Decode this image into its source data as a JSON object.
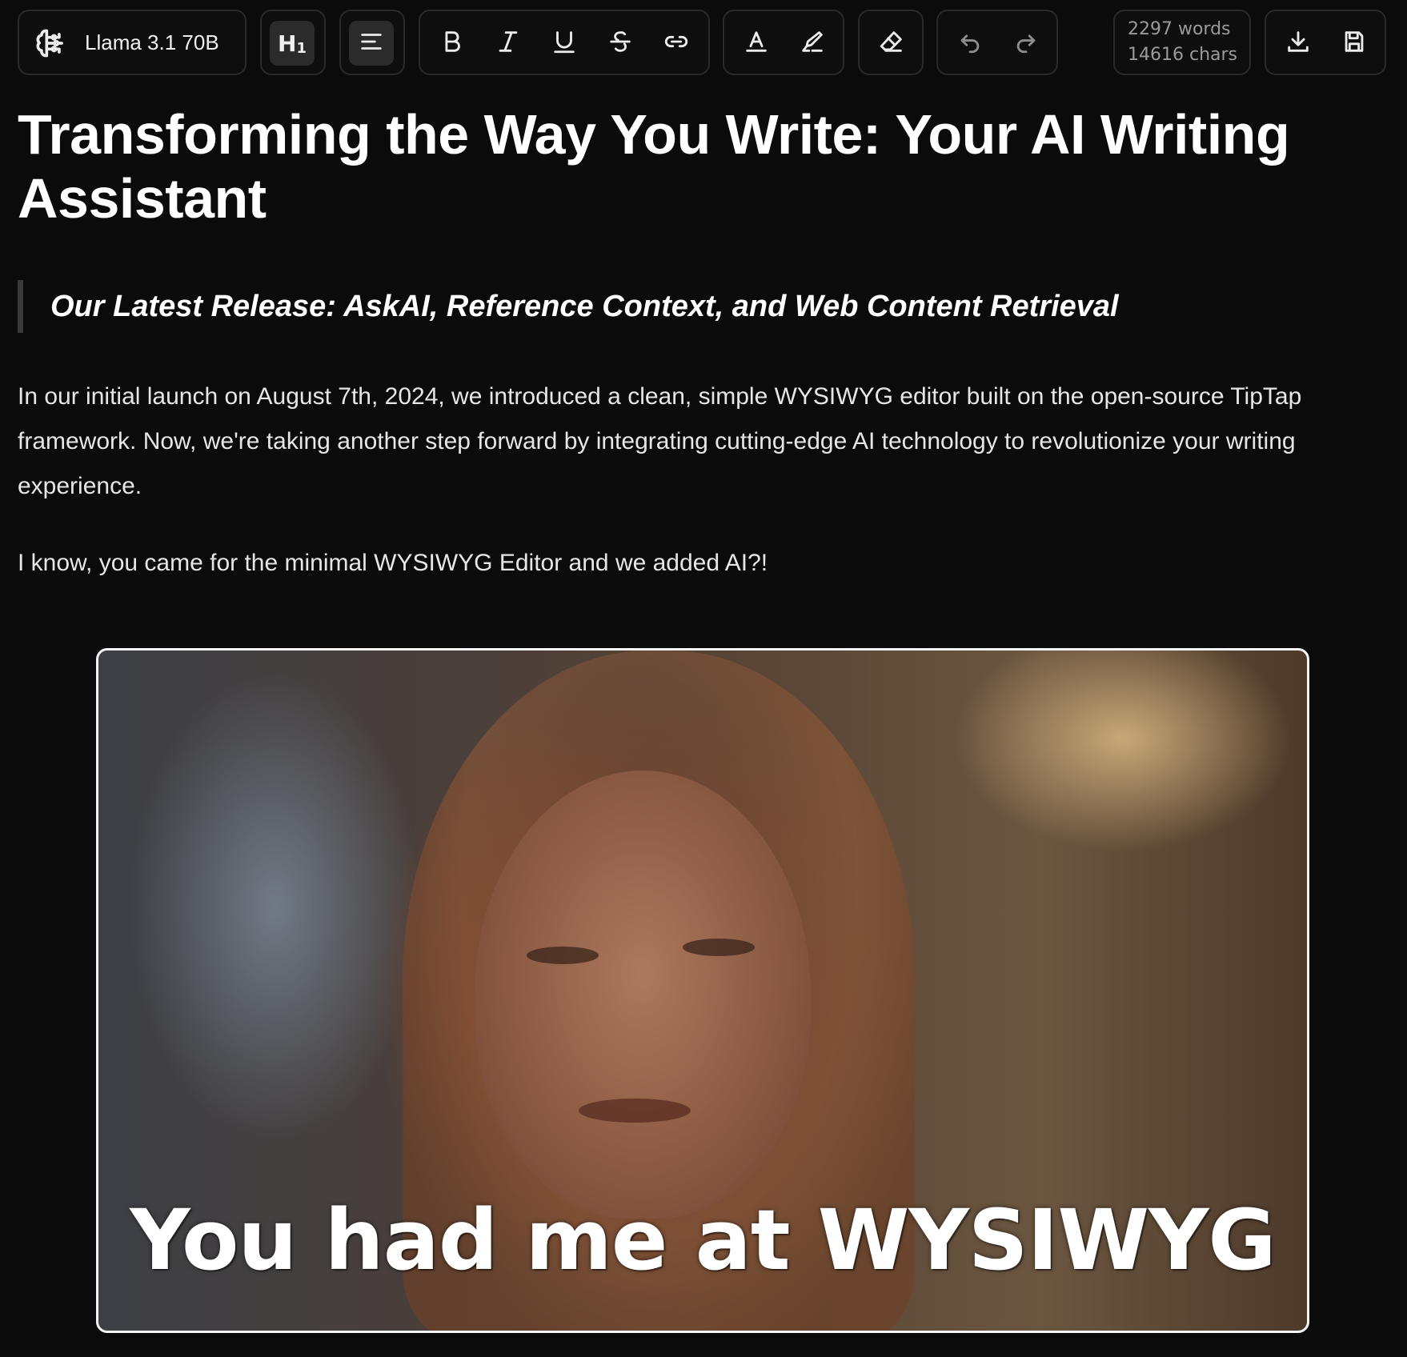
{
  "toolbar": {
    "model": {
      "label": "Llama 3.1 70B",
      "icon": "brain-icon"
    },
    "heading": {
      "label": "H",
      "level": "1"
    },
    "align": {
      "icon": "align-left-icon"
    },
    "format": {
      "icons": [
        "bold-icon",
        "italic-icon",
        "underline-icon",
        "strikethrough-icon",
        "link-icon"
      ]
    },
    "color": {
      "icons": [
        "text-color-icon",
        "highlighter-icon"
      ]
    },
    "clear": {
      "icon": "eraser-icon"
    },
    "history": {
      "icons": [
        "undo-icon",
        "redo-icon"
      ]
    },
    "stats": {
      "words": "2297 words",
      "chars": "14616 chars"
    },
    "file": {
      "icons": [
        "download-icon",
        "save-icon"
      ]
    }
  },
  "document": {
    "title": "Transforming the Way You Write: Your AI Writing Assistant",
    "blockquote": "Our Latest Release: AskAI, Reference Context, and Web Content Retrieval",
    "paragraphs": [
      "In our initial launch on August 7th, 2024, we introduced a clean, simple WYSIWYG editor built on the open-source TipTap framework. Now, we're taking another step forward by integrating cutting-edge AI technology to revolutionize your writing experience.",
      "I know, you came for the minimal WYSIWYG Editor and we added AI?!"
    ],
    "image": {
      "caption": "You had me at WYSIWYG"
    }
  },
  "colors": {
    "background": "#0b0b0b",
    "border": "#2a2a2a",
    "active": "#2b2b2b",
    "text": "#f2f2f2",
    "muted": "#9a9a9a"
  }
}
